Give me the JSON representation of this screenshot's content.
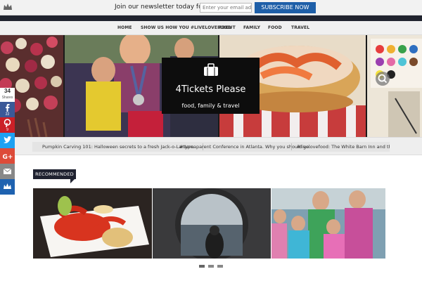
{
  "newsletter": {
    "text": "Join our newsletter today for free.",
    "input_placeholder": "Enter your email addre",
    "button_label": "SUBSCRIBE NOW"
  },
  "nav": {
    "items": [
      "HOME",
      "SHOW US HOW YOU #LIVELOVEFOOD",
      "ABOUT",
      "FAMILY",
      "FOOD",
      "TRAVEL"
    ]
  },
  "hero": {
    "site_title": "4Tickets Please",
    "tagline": "food, family & travel"
  },
  "ticker": {
    "items": [
      "Pumpkin Carving 101: Halloween secrets to a fresh Jack-o-Lantern",
      "#typeaparent Conference in Atlanta. Why you should go.",
      "#livelovefood: The White Barn Inn and the Histor"
    ]
  },
  "share": {
    "total": "34",
    "total_label": "Shares",
    "facebook_count": "22",
    "pinterest_count": "9"
  },
  "recommended": {
    "label": "RECOMMENDED"
  },
  "icons": [
    "crown-icon",
    "search-icon",
    "suitcase-icon",
    "facebook-icon",
    "pinterest-icon",
    "twitter-icon",
    "google-plus-icon",
    "email-icon",
    "sumome-icon"
  ],
  "colors": {
    "subscribe": "#1e5fa8",
    "dark": "#1f2230",
    "facebook": "#3b5998",
    "pinterest": "#cb2027",
    "twitter": "#1da1f2",
    "google": "#dd4b39",
    "email": "#888888",
    "sumome": "#1e62b0"
  }
}
